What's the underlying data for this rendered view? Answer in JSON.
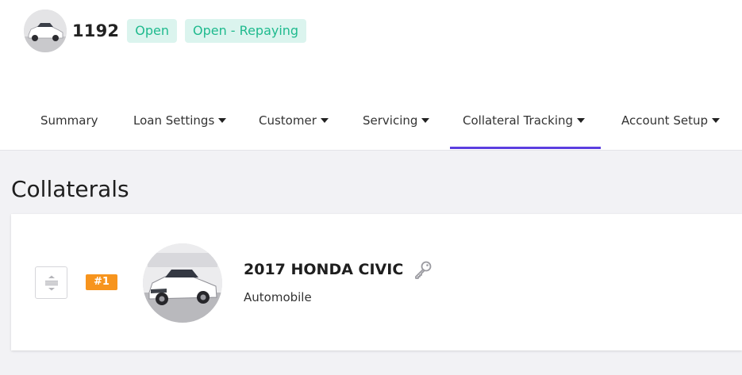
{
  "loan": {
    "id": "1192",
    "status_badge": "Open",
    "sub_status_badge": "Open - Repaying"
  },
  "tabs": [
    {
      "label": "Summary",
      "has_caret": false
    },
    {
      "label": "Loan Settings",
      "has_caret": true
    },
    {
      "label": "Customer",
      "has_caret": true
    },
    {
      "label": "Servicing",
      "has_caret": true
    },
    {
      "label": "Collateral Tracking",
      "has_caret": true,
      "active": true
    },
    {
      "label": "Account Setup",
      "has_caret": true
    }
  ],
  "page": {
    "title": "Collaterals"
  },
  "collaterals": [
    {
      "index_badge": "#1",
      "title": "2017 HONDA CIVIC",
      "type": "Automobile"
    }
  ],
  "colors": {
    "accent": "#5b3ee0",
    "badge_bg": "#dbf4ee",
    "badge_text": "#1fba8e",
    "index_badge": "#f7941d"
  },
  "icons": [
    "car-photo-avatar",
    "caret-down-icon",
    "drag-handle-icon",
    "key-icon"
  ]
}
